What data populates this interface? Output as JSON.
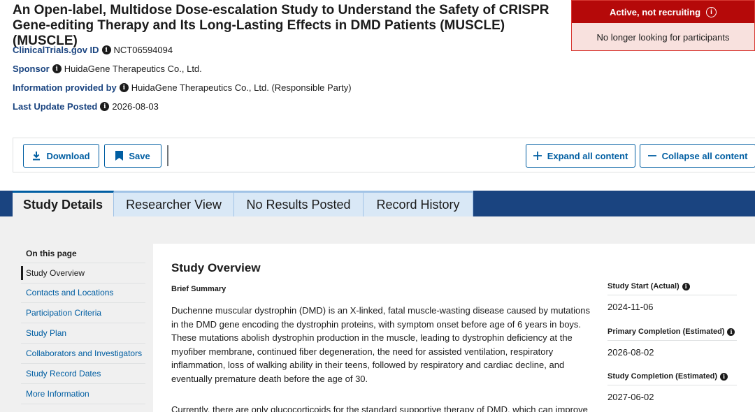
{
  "title": "An Open-label, Multidose Dose-escalation Study to Understand the Safety of CRISPR Gene-editing Therapy and Its Long-Lasting Effects in DMD Patients (MUSCLE) (MUSCLE)",
  "status": {
    "label": "Active, not recruiting",
    "sublabel": "No longer looking for participants",
    "icon": "info-circle-icon",
    "color": "#b50909"
  },
  "meta": {
    "nct_label": "ClinicalTrials.gov ID",
    "nct_value": "NCT06594094",
    "sponsor_label": "Sponsor",
    "sponsor_value": "HuidaGene Therapeutics Co., Ltd.",
    "info_label": "Information provided by",
    "info_value": "HuidaGene Therapeutics Co., Ltd. (Responsible Party)",
    "update_label": "Last Update Posted",
    "update_value": "2026-08-03"
  },
  "toolbar": {
    "download_label": "Download",
    "save_label": "Save",
    "expand_label": "Expand all content",
    "collapse_label": "Collapse all content"
  },
  "tabs": [
    {
      "label": "Study Details",
      "active": true
    },
    {
      "label": "Researcher View",
      "active": false
    },
    {
      "label": "No Results Posted",
      "active": false
    },
    {
      "label": "Record History",
      "active": false
    }
  ],
  "toc": {
    "title": "On this page",
    "items": [
      "Study Overview",
      "Contacts and Locations",
      "Participation Criteria",
      "Study Plan",
      "Collaborators and Investigators",
      "Study Record Dates",
      "More Information"
    ]
  },
  "overview": {
    "heading": "Study Overview",
    "subheading": "Brief Summary",
    "para1": "Duchenne muscular dystrophin (DMD) is an X-linked, fatal muscle-wasting disease caused by mutations in the DMD gene encoding the dystrophin proteins, with symptom onset before age of 6 years in boys. These mutations abolish dystrophin production in the muscle, leading to dystrophin deficiency at the myofiber membrane, continued fiber degeneration, the need for assisted ventilation, respiratory inflammation, loss of walking ability in their teens, followed by respiratory and cardiac decline, and eventually premature death before the age of 30.",
    "para2": "Currently, there are only glucocorticoids for the standard supportive therapy of DMD, which can improve"
  },
  "dates": {
    "start_label": "Study Start (Actual)",
    "start_value": "2024-11-06",
    "primary_label": "Primary Completion (Estimated)",
    "primary_value": "2026-08-02",
    "completion_label": "Study Completion (Estimated)",
    "completion_value": "2027-06-02"
  }
}
